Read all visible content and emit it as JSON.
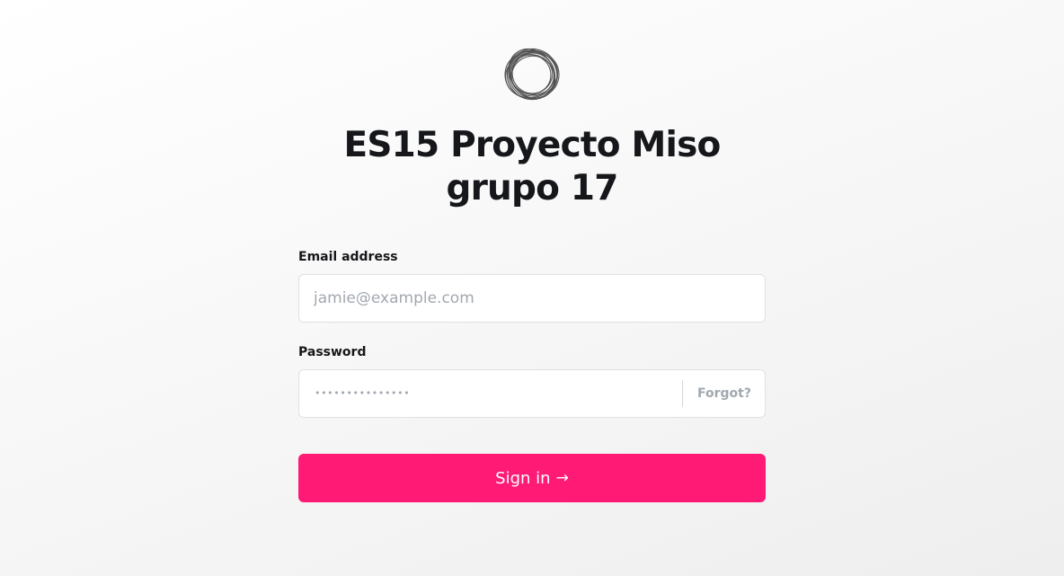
{
  "logo": {
    "icon": "ghost-ring-logo-icon"
  },
  "page_title": "ES15 Proyecto Miso grupo 17",
  "form": {
    "email": {
      "label": "Email address",
      "placeholder": "jamie@example.com",
      "value": ""
    },
    "password": {
      "label": "Password",
      "placeholder_dots": "•••••••••••••••",
      "forgot_label": "Forgot?"
    },
    "submit": {
      "label": "Sign in",
      "arrow": "→",
      "color": "#ff1a75"
    }
  }
}
